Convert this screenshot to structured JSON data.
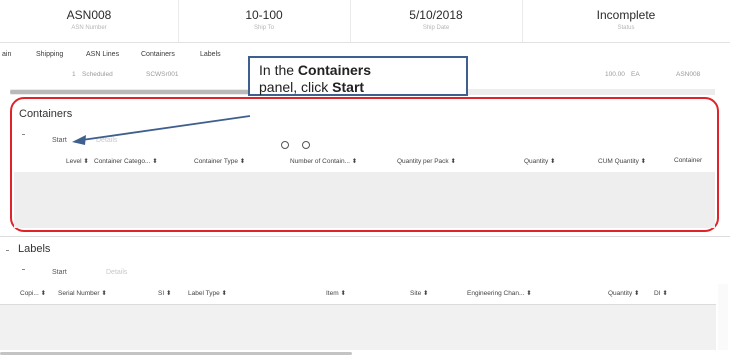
{
  "header": [
    {
      "value": "ASN008",
      "label": "ASN Number"
    },
    {
      "value": "10-100",
      "label": "Ship To"
    },
    {
      "value": "5/10/2018",
      "label": "Ship Date"
    },
    {
      "value": "Incomplete",
      "label": "Status"
    }
  ],
  "tabs": [
    "ain",
    "Shipping",
    "ASN Lines",
    "Containers",
    "Labels"
  ],
  "faint_row": {
    "num": "1",
    "status": "Scheduled",
    "code": "SCWSr001",
    "qty": "100.00",
    "unit": "EA",
    "asn": "ASN008"
  },
  "callout": {
    "line1_pre": "In the ",
    "line1_bold": "Containers",
    "line2_pre": "panel, click ",
    "line2_bold": "Start"
  },
  "containers": {
    "title": "Containers",
    "start_label": "Start",
    "details_label": "Details",
    "columns": [
      "Level",
      "Container Catego...",
      "Container Type",
      "Number of Contain...",
      "Quantity per Pack",
      "Quantity",
      "CUM Quantity",
      "Container"
    ]
  },
  "labels": {
    "title": "Labels",
    "start_label": "Start",
    "details_label": "Details",
    "columns": [
      "Copi...",
      "Serial Number",
      "SI",
      "Label Type",
      "Item",
      "Site",
      "Engineering Chan...",
      "Quantity",
      "DI"
    ]
  },
  "sort_glyph": "⬍",
  "colors": {
    "highlight": "#e0232a",
    "callout_border": "#3f5f8e",
    "arrow": "#3f5f8e"
  }
}
